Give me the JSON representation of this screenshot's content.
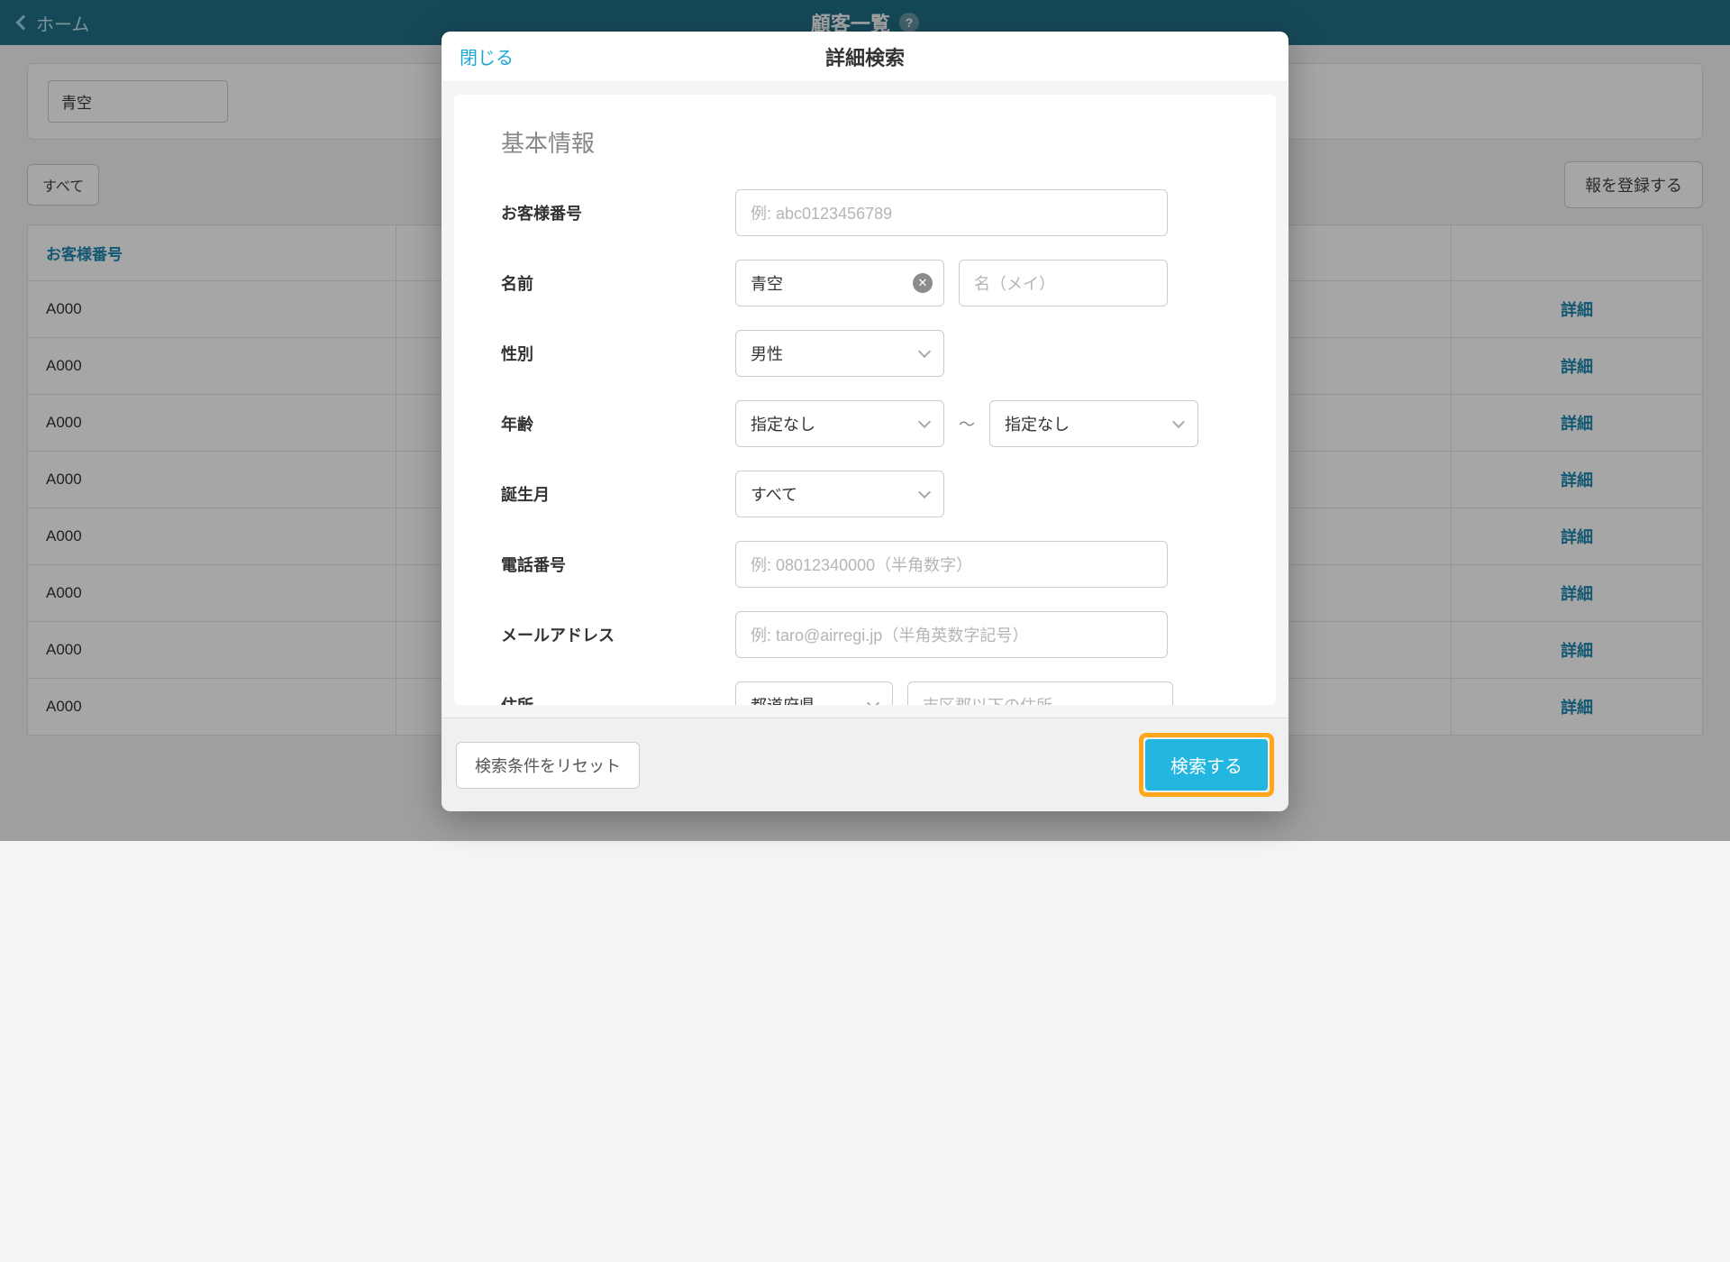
{
  "topbar": {
    "back_label": "ホーム",
    "title": "顧客一覧",
    "help_glyph": "?"
  },
  "bg": {
    "search_value": "青空",
    "filter_all": "すべて",
    "register_label": "報を登録する",
    "col_customer_no": "お客様番号",
    "detail_link": "詳細",
    "rows": [
      {
        "id": "A000"
      },
      {
        "id": "A000"
      },
      {
        "id": "A000"
      },
      {
        "id": "A000"
      },
      {
        "id": "A000"
      },
      {
        "id": "A000"
      },
      {
        "id": "A000"
      },
      {
        "id": "A000"
      }
    ]
  },
  "modal": {
    "close": "閉じる",
    "title": "詳細検索",
    "section_title": "基本情報",
    "labels": {
      "customer_no": "お客様番号",
      "name": "名前",
      "gender": "性別",
      "age": "年齢",
      "birth_month": "誕生月",
      "phone": "電話番号",
      "email": "メールアドレス",
      "address": "住所"
    },
    "placeholders": {
      "customer_no": "例: abc0123456789",
      "first_name": "名（メイ）",
      "phone": "例: 08012340000（半角数字）",
      "email": "例: taro@airregi.jp（半角英数字記号）",
      "address2": "市区郡以下の住所"
    },
    "values": {
      "last_name": "青空",
      "gender": "男性",
      "age_from": "指定なし",
      "age_to": "指定なし",
      "birth_month": "すべて",
      "prefecture": "都道府県"
    },
    "tilde": "〜",
    "clear_glyph": "✕",
    "footer": {
      "reset": "検索条件をリセット",
      "search": "検索する"
    }
  }
}
